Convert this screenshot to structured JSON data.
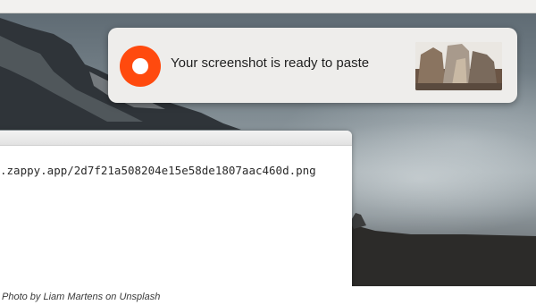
{
  "notification": {
    "message": "Your screenshot is ready to paste",
    "app_logo_icon": "zappy-ring-icon",
    "accent_color": "#ff4a0e"
  },
  "browser": {
    "url_text": ".zappy.app/2d7f21a508204e15e58de1807aac460d.png"
  },
  "caption": "Photo by Liam Martens on Unsplash"
}
